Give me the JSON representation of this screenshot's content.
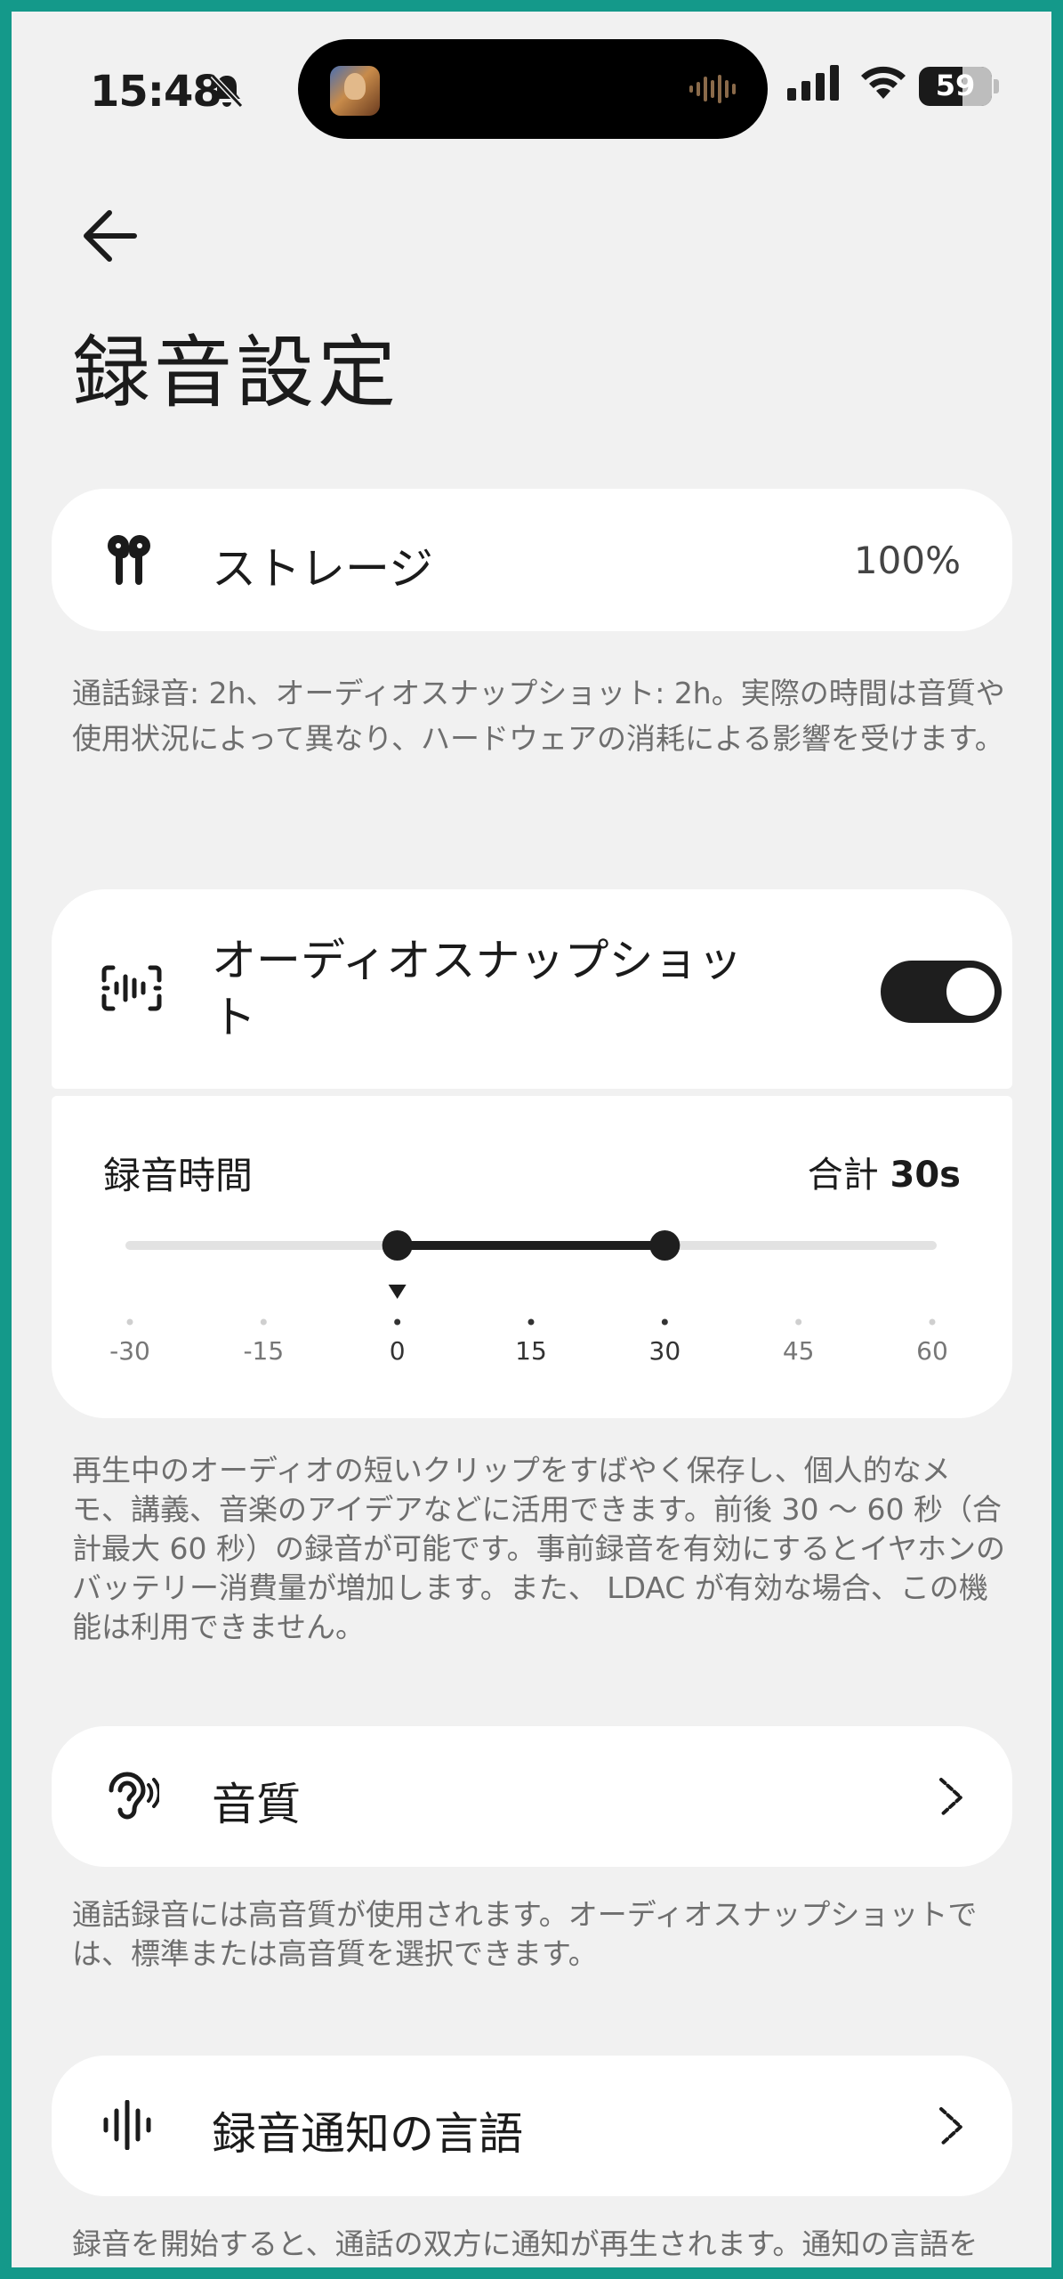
{
  "status": {
    "time": "15:48",
    "battery": "59"
  },
  "page": {
    "title": "録音設定"
  },
  "storage": {
    "label": "ストレージ",
    "value": "100%",
    "note": "通話録音: 2h、オーディオスナップショット: 2h。実際の時間は音質や使用状況によって異なり、ハードウェアの消耗による影響を受けます。"
  },
  "snapshot": {
    "label": "オーディオスナップショット",
    "enabled": true,
    "recording_time_label": "録音時間",
    "total_prefix": "合計",
    "total_value": "30s",
    "range_start": 0,
    "range_end": 30,
    "marker": 0,
    "ticks": [
      "-30",
      "-15",
      "0",
      "15",
      "30",
      "45",
      "60"
    ],
    "note": "再生中のオーディオの短いクリップをすばやく保存し、個人的なメモ、講義、音楽のアイデアなどに活用できます。前後 30 〜 60 秒（合計最大 60 秒）の録音が可能です。事前録音を有効にするとイヤホンのバッテリー消費量が増加します。また、 LDAC が有効な場合、この機能は利用できません。"
  },
  "quality": {
    "label": "音質",
    "note": "通話録音には高音質が使用されます。オーディオスナップショットでは、標準または高音質を選択できます。"
  },
  "language": {
    "label": "録音通知の言語",
    "note": "録音を開始すると、通話の双方に通知が再生されます。通知の言語を選択できます。"
  },
  "icons": [
    "back-arrow-icon",
    "earbuds-icon",
    "audio-snapshot-icon",
    "ear-icon",
    "waveform-icon",
    "chevron-right-icon",
    "bell-mute-icon",
    "signal-icon",
    "wifi-icon"
  ]
}
